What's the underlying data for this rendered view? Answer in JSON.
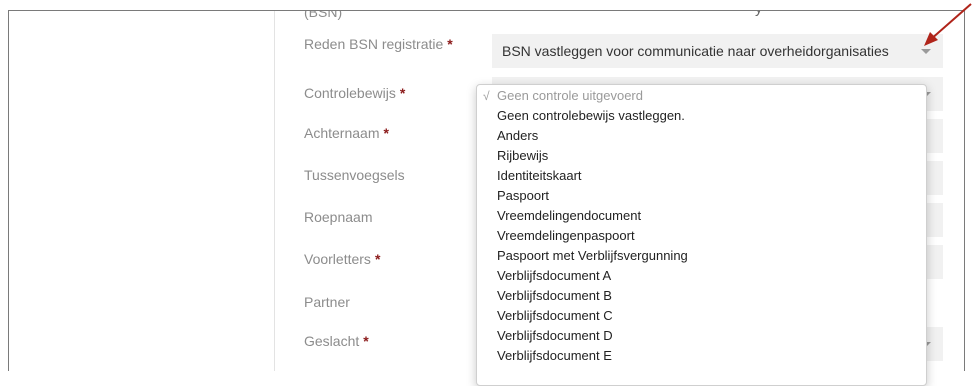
{
  "header": {
    "partial_title": "y",
    "partial_label": "(BSN)"
  },
  "form": {
    "fields": [
      {
        "label": "Reden BSN registratie",
        "required": "*",
        "value": "BSN vastleggen voor communicatie naar overheidorganisaties"
      },
      {
        "label": "Controlebewijs",
        "required": "*"
      },
      {
        "label": "Achternaam",
        "required": "*"
      },
      {
        "label": "Tussenvoegsels"
      },
      {
        "label": "Roepnaam"
      },
      {
        "label": "Voorletters",
        "required": "*"
      },
      {
        "label": "Partner"
      },
      {
        "label": "Geslacht",
        "required": "*"
      }
    ]
  },
  "dropdown": {
    "check_mark": "√",
    "options": [
      "Geen controle uitgevoerd",
      "Geen controlebewijs vastleggen.",
      "Anders",
      "Rijbewijs",
      "Identiteitskaart",
      "Paspoort",
      "Vreemdelingendocument",
      "Vreemdelingenpaspoort",
      "Paspoort met Verblijfsvergunning",
      "Verblijfsdocument A",
      "Verblijfsdocument B",
      "Verblijfsdocument C",
      "Verblijfsdocument D",
      "Verblijfsdocument E"
    ],
    "selected_index": 0
  },
  "colors": {
    "required": "#8b1a1a",
    "arrow": "#b0241a",
    "field_bg": "#f1f1f1"
  },
  "icons": {
    "caret": "chevron-down-icon",
    "annotation": "red-arrow-annotation"
  }
}
